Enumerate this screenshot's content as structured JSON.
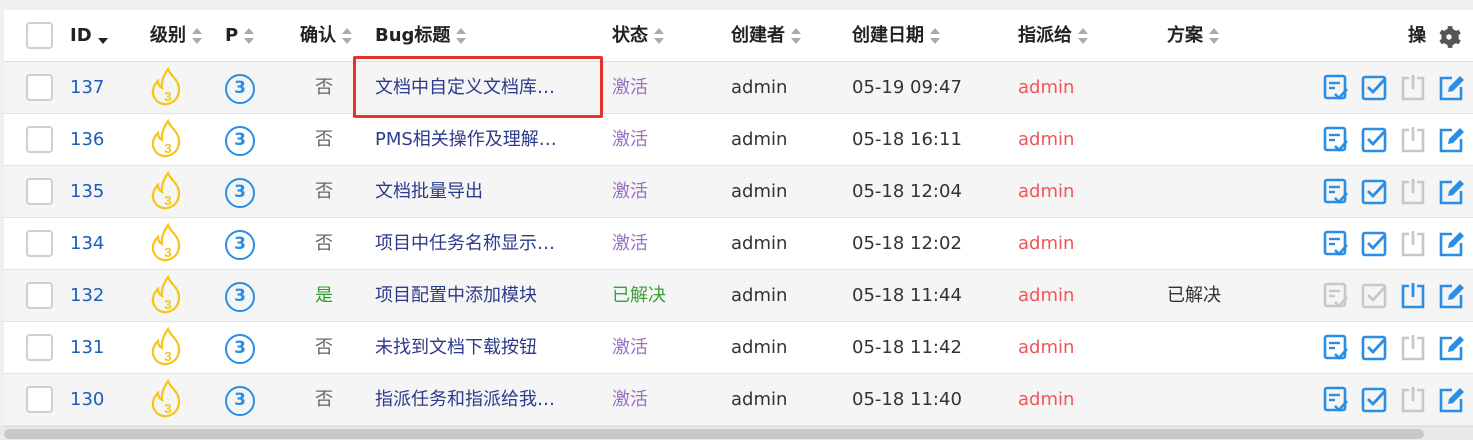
{
  "header": {
    "id": "ID",
    "severity": "级别",
    "priority": "P",
    "confirmed": "确认",
    "title": "Bug标题",
    "status": "状态",
    "creator": "创建者",
    "created_date": "创建日期",
    "assigned_to": "指派给",
    "resolution": "方案",
    "actions": "操"
  },
  "rows": [
    {
      "id": "137",
      "severity": "3",
      "priority": "3",
      "confirmed": "否",
      "title": "文档中自定义文档库…",
      "status": "激活",
      "status_type": "active",
      "creator": "admin",
      "date": "05-19 09:47",
      "assigned": "admin",
      "resolution": ""
    },
    {
      "id": "136",
      "severity": "3",
      "priority": "3",
      "confirmed": "否",
      "title": "PMS相关操作及理解…",
      "status": "激活",
      "status_type": "active",
      "creator": "admin",
      "date": "05-18 16:11",
      "assigned": "admin",
      "resolution": ""
    },
    {
      "id": "135",
      "severity": "3",
      "priority": "3",
      "confirmed": "否",
      "title": "文档批量导出",
      "status": "激活",
      "status_type": "active",
      "creator": "admin",
      "date": "05-18 12:04",
      "assigned": "admin",
      "resolution": ""
    },
    {
      "id": "134",
      "severity": "3",
      "priority": "3",
      "confirmed": "否",
      "title": "项目中任务名称显示…",
      "status": "激活",
      "status_type": "active",
      "creator": "admin",
      "date": "05-18 12:02",
      "assigned": "admin",
      "resolution": ""
    },
    {
      "id": "132",
      "severity": "3",
      "priority": "3",
      "confirmed": "是",
      "title": "项目配置中添加模块",
      "status": "已解决",
      "status_type": "resolved",
      "creator": "admin",
      "date": "05-18 11:44",
      "assigned": "admin",
      "resolution": "已解决"
    },
    {
      "id": "131",
      "severity": "3",
      "priority": "3",
      "confirmed": "否",
      "title": "未找到文档下载按钮",
      "status": "激活",
      "status_type": "active",
      "creator": "admin",
      "date": "05-18 11:42",
      "assigned": "admin",
      "resolution": ""
    },
    {
      "id": "130",
      "severity": "3",
      "priority": "3",
      "confirmed": "否",
      "title": "指派任务和指派给我…",
      "status": "激活",
      "status_type": "active",
      "creator": "admin",
      "date": "05-18 11:40",
      "assigned": "admin",
      "resolution": ""
    }
  ],
  "colors": {
    "link": "#1a5dbc",
    "title": "#2d3a8c",
    "status_active": "#9b6fc9",
    "status_resolved": "#3aa13a",
    "assigned": "#f2545b",
    "icon_blue": "#2a8de6",
    "icon_disabled": "#c8c8c8",
    "severity_yellow": "#f5c518",
    "highlight": "#e5332a"
  },
  "icons": {
    "severity": "flame-icon",
    "confirm_bug": "confirm-icon",
    "resolve": "resolve-check-icon",
    "close": "close-bug-icon",
    "edit": "edit-icon",
    "settings": "gear-icon"
  }
}
